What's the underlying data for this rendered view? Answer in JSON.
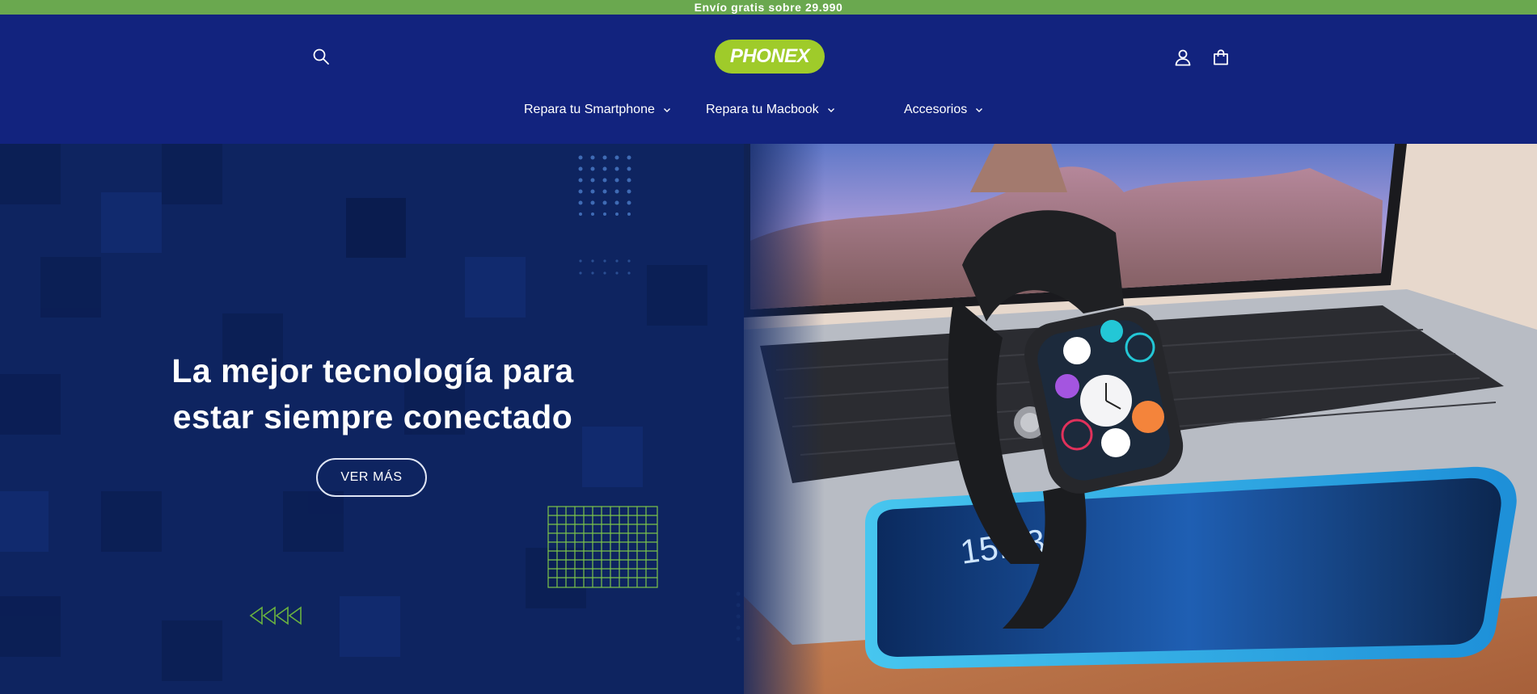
{
  "announcement": {
    "text": "Envío gratis sobre 29.990"
  },
  "header": {
    "logo_text": "PHONEX",
    "icons": {
      "search": "search-icon",
      "account": "user-icon",
      "cart": "cart-icon"
    },
    "nav": [
      {
        "label": "Repara tu Smartphone"
      },
      {
        "label": "Repara tu Macbook"
      },
      {
        "label": "Accesorios"
      }
    ]
  },
  "hero": {
    "title": "La mejor tecnología para estar siempre conectado",
    "button_label": "VER MÁS"
  },
  "colors": {
    "announcement_bg": "#6aa84f",
    "header_bg": "#12237e",
    "logo_bg": "#9fcb2a",
    "hero_bg": "#0e2460",
    "accent_green": "#8fd14f"
  }
}
